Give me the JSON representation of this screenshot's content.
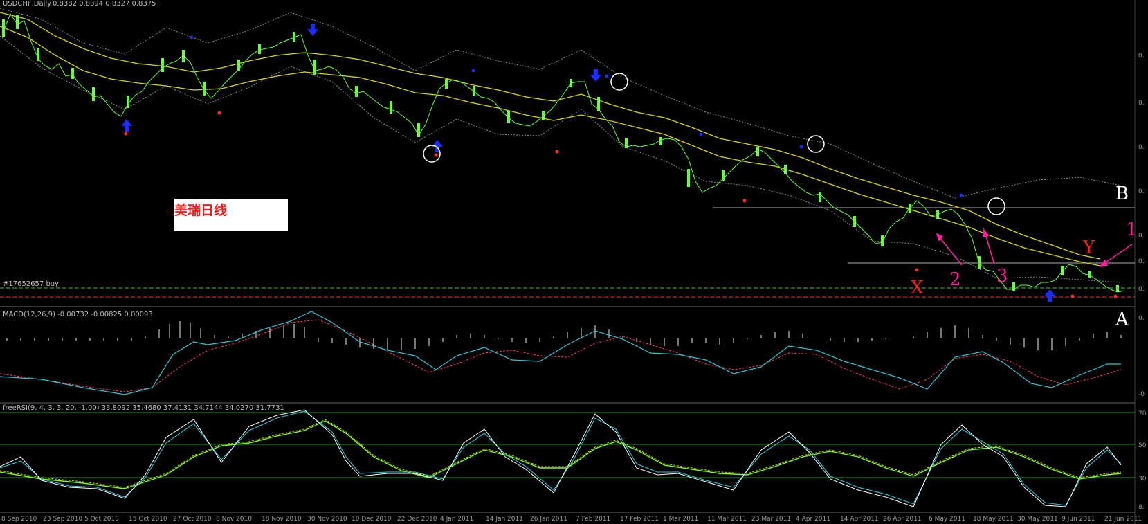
{
  "window": {
    "symbol_header": "USDCHF,Daily",
    "header_values": "0.8382 0.8394 0.8327 0.8375",
    "order_label": "#17652657 buy"
  },
  "note_label": "美瑞日线",
  "markers": {
    "x": "X",
    "y": "Y",
    "a": "A",
    "b": "B",
    "one": "1",
    "two": "2",
    "three": "3"
  },
  "colors": {
    "background": "#000000",
    "candle": "#66ff33",
    "ma": "#d8d800",
    "band": "#8c8c8c",
    "arrow": "#1c2bff",
    "dot_red": "#ff2a2a",
    "macd_main": "#2ec6d4",
    "macd_signal": "#ff3b6a",
    "rsi_grid": "#1f9a1f",
    "annotation_pink": "#ff1fa0",
    "annotation_red": "#ff1a1a"
  },
  "macd": {
    "header": "MACD(12,26,9) -0.00732 -0.00825 0.00093"
  },
  "rsi": {
    "header": "freeRSI(9, 4, 3, 3, 20, -1.00) 33.8092 35.4680 37.4131 34.7144 34.0270 31.7731"
  },
  "time_axis": [
    "8 Sep 2010",
    "23 Sep 2010",
    "5 Oct 2010",
    "15 Oct 2010",
    "27 Oct 2010",
    "8 Nov 2010",
    "18 Nov 2010",
    "30 Nov 2010",
    "10 Dec 2010",
    "22 Dec 2010",
    "4 Jan 2011",
    "14 Jan 2011",
    "26 Jan 2011",
    "7 Feb 2011",
    "17 Feb 2011",
    "1 Mar 2011",
    "11 Mar 2011",
    "23 Mar 2011",
    "4 Apr 2011",
    "14 Apr 2011",
    "26 Apr 2011",
    "6 May 2011",
    "18 May 2011",
    "30 May 2011",
    "9 Jun 2011",
    "21 Jun 2011"
  ],
  "icons": {
    "up_arrow": "blue-up-arrow-icon",
    "down_arrow": "blue-down-arrow-icon",
    "fractal_dot": "red-dot-icon",
    "circle_highlight": "white-circle-icon"
  }
}
